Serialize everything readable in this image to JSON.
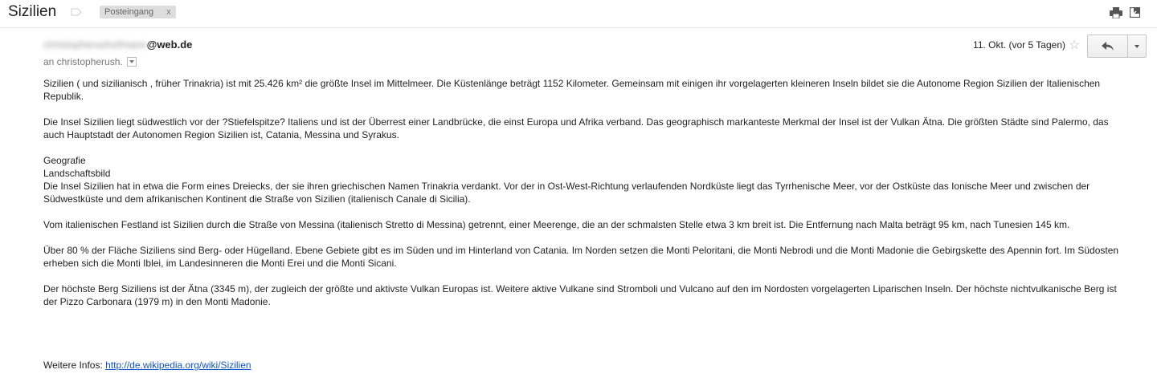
{
  "header": {
    "subject": "Sizilien",
    "label_chip": "Posteingang",
    "chip_close": "x"
  },
  "message": {
    "sender_hidden": "christopherushofmann",
    "sender_domain": "@web.de",
    "recipient": "an christopherush.",
    "date": "11. Okt. (vor 5 Tagen)"
  },
  "body": {
    "p1": "Sizilien ( und sizilianisch , früher Trinakria) ist mit 25.426 km² die größte Insel im Mittelmeer. Die Küstenlänge beträgt 1152 Kilometer.     Gemeinsam mit einigen ihr vorgelagerten kleineren Inseln bildet sie die Autonome Region Sizilien der Italienischen Republik.",
    "p2": "Die Insel Sizilien liegt südwestlich vor der ?Stiefelspitze? Italiens und ist der Überrest einer Landbrücke, die einst Europa und Afrika verband. Das geographisch markanteste Merkmal der Insel ist der Vulkan Ätna. Die größten Städte sind Palermo, das auch Hauptstadt der Autonomen Region Sizilien ist, Catania, Messina und Syrakus.",
    "h1": "Geografie",
    "h2": "Landschaftsbild",
    "p3": "Die Insel Sizilien hat in etwa die Form eines Dreiecks, der sie ihren griechischen Namen Trinakria verdankt. Vor der in Ost-West-Richtung verlaufenden Nordküste liegt das Tyrrhenische Meer, vor der Ostküste das Ionische Meer und zwischen der Südwestküste und dem afrikanischen Kontinent die Straße von Sizilien (italienisch Canale di Sicilia).",
    "p4": "Vom italienischen Festland ist Sizilien durch die Straße von Messina (italienisch Stretto di Messina) getrennt, einer Meerenge, die an der schmalsten Stelle etwa 3 km breit ist. Die Entfernung nach Malta beträgt 95 km, nach Tunesien 145 km.",
    "p5": "Über 80 % der Fläche Siziliens sind Berg- oder Hügelland. Ebene Gebiete gibt es im Süden und im Hinterland von Catania. Im Norden setzen die Monti Peloritani, die Monti Nebrodi und die Monti Madonie die Gebirgskette des Apennin fort. Im Südosten erheben sich die Monti Iblei, im Landesinneren die Monti Erei und die Monti Sicani.",
    "p6": "Der höchste Berg Siziliens ist der Ätna (3345 m), der zugleich der größte und aktivste Vulkan Europas ist. Weitere aktive Vulkane sind Stromboli und Vulcano auf den im Nordosten vorgelagerten Liparischen Inseln. Der höchste nichtvulkanische Berg ist der Pizzo Carbonara (1979 m) in den Monti Madonie."
  },
  "footer": {
    "label": "Weitere Infos: ",
    "link": "http://de.wikipedia.org/wiki/Sizilien"
  },
  "icons": {
    "label": "label-icon",
    "print": "print-icon",
    "popout": "popout-icon",
    "star": "star-icon",
    "reply": "reply-icon",
    "more": "chevron-down-icon"
  }
}
